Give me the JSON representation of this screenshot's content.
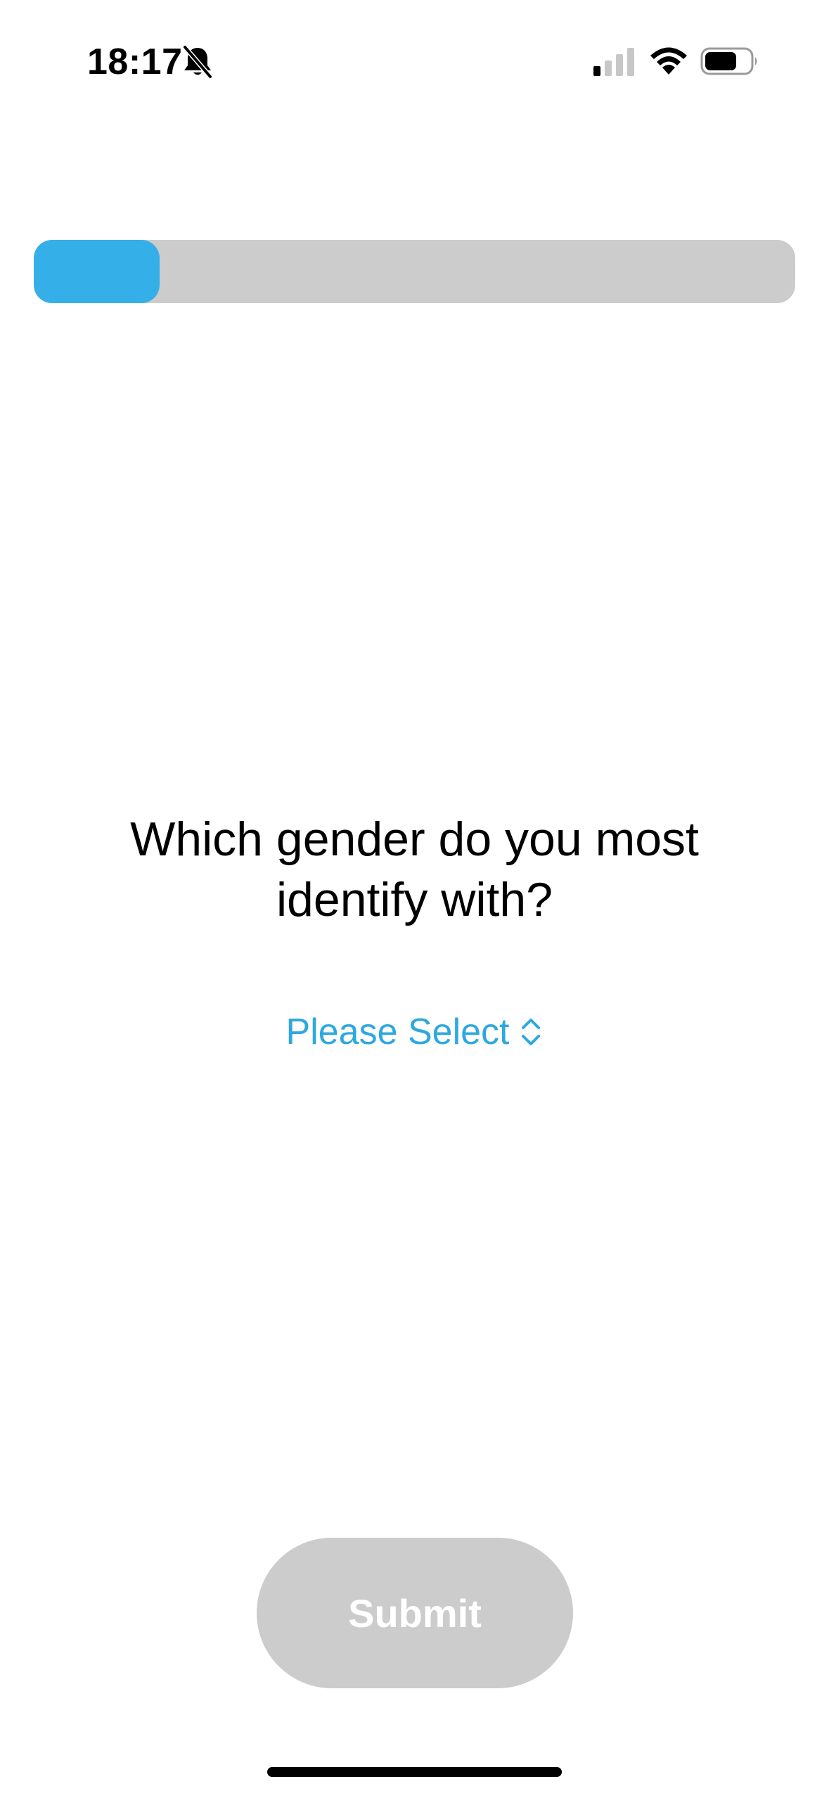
{
  "status_bar": {
    "time": "18:17",
    "icons": [
      "bell-slash-icon",
      "cellular-signal-icon",
      "wifi-icon",
      "battery-icon"
    ]
  },
  "progress": {
    "fraction": 0.165,
    "fill_color": "#35afe8",
    "track_color": "#cccccc"
  },
  "question": {
    "text": "Which gender do you most identify with?"
  },
  "picker": {
    "selected_label": "Please Select",
    "icon": "chevron-up-down-icon",
    "color": "#2ea8e0"
  },
  "submit": {
    "label": "Submit",
    "state": "disabled",
    "background": "#cccccc"
  }
}
